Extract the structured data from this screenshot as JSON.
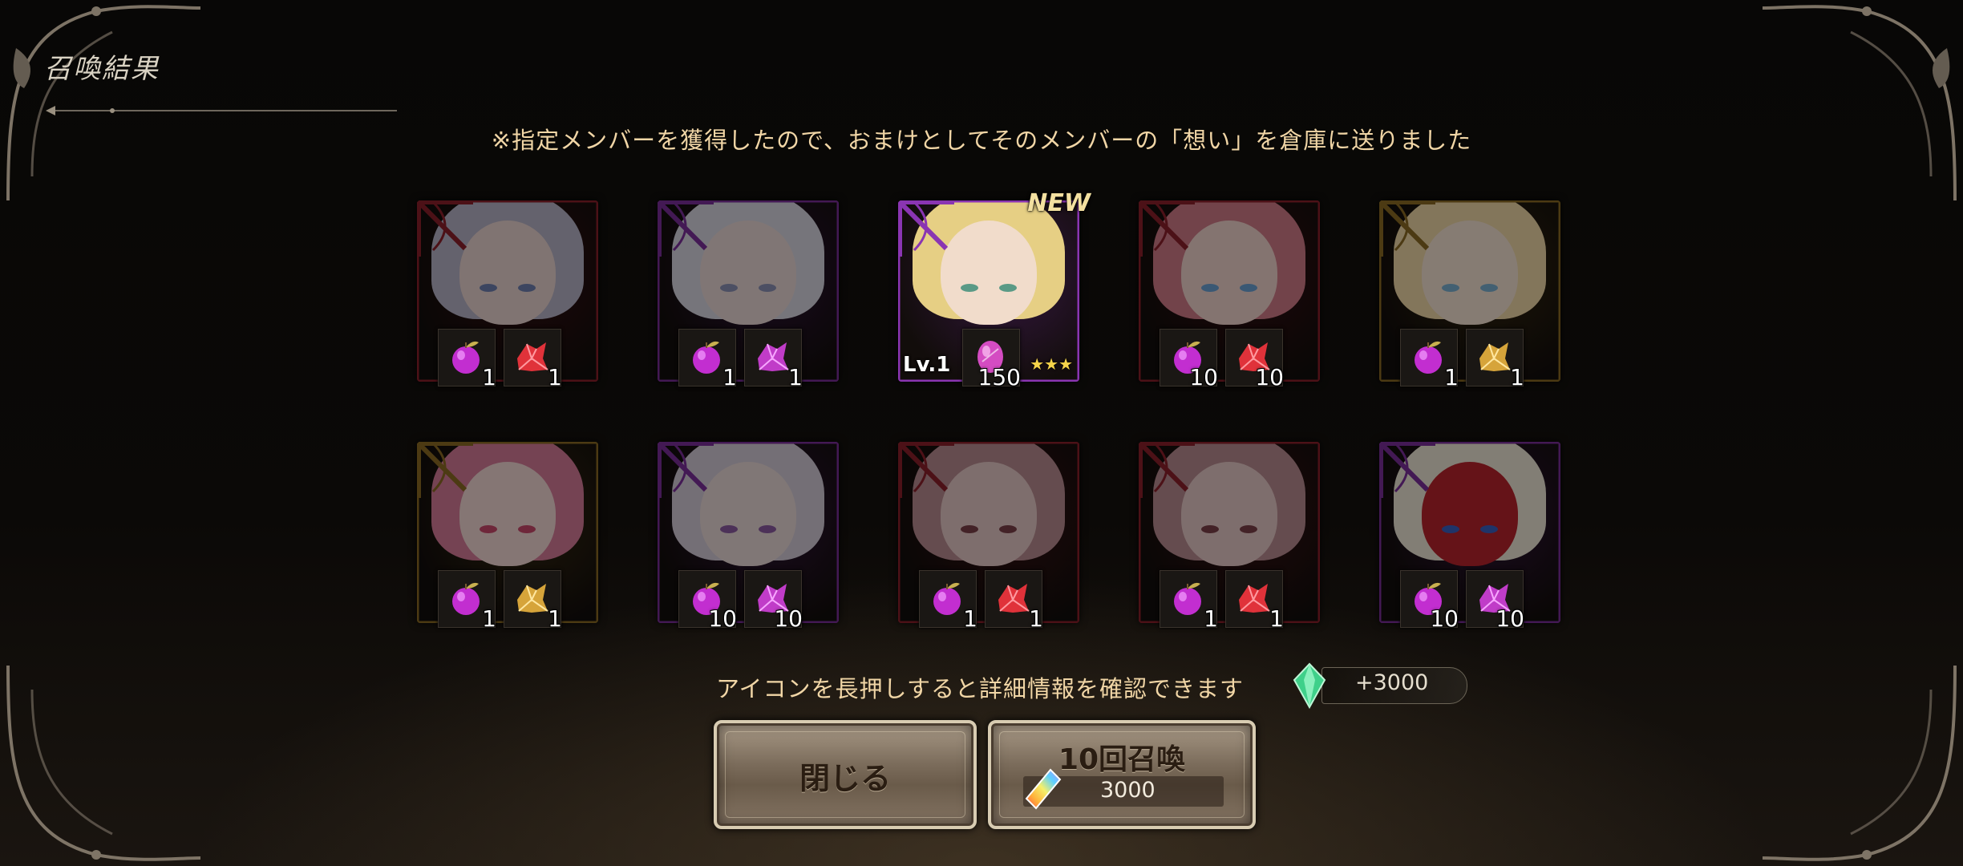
{
  "header": {
    "title": "召喚結果"
  },
  "notice": "※指定メンバーを獲得したので、おまけとしてそのメンバーの「想い」を倉庫に送りました",
  "results": [
    {
      "frame": "#8b1f2a",
      "hair": "#b7b2c6",
      "skin": "#e9d3cf",
      "eye": "#6e7fb0",
      "item1": {
        "type": "apple",
        "qty": "1"
      },
      "item2": {
        "type": "crystal-red",
        "qty": "1"
      }
    },
    {
      "frame": "#7a2f9a",
      "hair": "#d8d6e0",
      "skin": "#e9d8d6",
      "eye": "#8a90b4",
      "item1": {
        "type": "apple",
        "qty": "1"
      },
      "item2": {
        "type": "crystal-pink",
        "qty": "1"
      }
    },
    {
      "frame": "#8a35b2",
      "hair": "#e6cf84",
      "skin": "#f1dccb",
      "eye": "#5a9a86",
      "is_new": true,
      "new_label": "NEW",
      "level": "Lv.1",
      "stars": "★★★",
      "item1": {
        "type": "soul",
        "qty": "150"
      }
    },
    {
      "frame": "#8b1f2a",
      "hair": "#d07a88",
      "skin": "#f1d3cc",
      "eye": "#6aa0d4",
      "item1": {
        "type": "apple",
        "qty": "10"
      },
      "item2": {
        "type": "crystal-red",
        "qty": "10"
      }
    },
    {
      "frame": "#8a6a24",
      "hair": "#efd7a6",
      "skin": "#f4e2d2",
      "eye": "#7ab0d0",
      "item1": {
        "type": "apple",
        "qty": "1"
      },
      "item2": {
        "type": "crystal-gold",
        "qty": "1"
      }
    },
    {
      "frame": "#8a6a24",
      "hair": "#d57a98",
      "skin": "#f3d7d4",
      "eye": "#c8476a",
      "item1": {
        "type": "apple",
        "qty": "1"
      },
      "item2": {
        "type": "crystal-gold",
        "qty": "1"
      }
    },
    {
      "frame": "#7a2f9a",
      "hair": "#d3cad8",
      "skin": "#ead9d8",
      "eye": "#8a5aa0",
      "item1": {
        "type": "apple",
        "qty": "10"
      },
      "item2": {
        "type": "crystal-pink",
        "qty": "10"
      }
    },
    {
      "frame": "#8b1f2a",
      "hair": "#b98a90",
      "skin": "#e6c9c6",
      "eye": "#7a3f48",
      "item1": {
        "type": "apple",
        "qty": "1"
      },
      "item2": {
        "type": "crystal-red",
        "qty": "1"
      }
    },
    {
      "frame": "#8b1f2a",
      "hair": "#b98a90",
      "skin": "#e6c9c6",
      "eye": "#7a3f48",
      "item1": {
        "type": "apple",
        "qty": "1"
      },
      "item2": {
        "type": "crystal-red",
        "qty": "1"
      }
    },
    {
      "frame": "#7a2f9a",
      "hair": "#ede6d6",
      "skin": "#b8232c",
      "eye": "#3a5fc0",
      "item1": {
        "type": "apple",
        "qty": "10"
      },
      "item2": {
        "type": "crystal-pink",
        "qty": "10"
      }
    }
  ],
  "hint": "アイコンを長押しすると詳細情報を確認できます",
  "reward": {
    "icon": "green-crystal-icon",
    "value": "+3000"
  },
  "buttons": {
    "close_label": "閉じる",
    "summon_label": "10回召喚",
    "summon_cost": "3000",
    "summon_cost_icon": "rainbow-gem-icon"
  }
}
